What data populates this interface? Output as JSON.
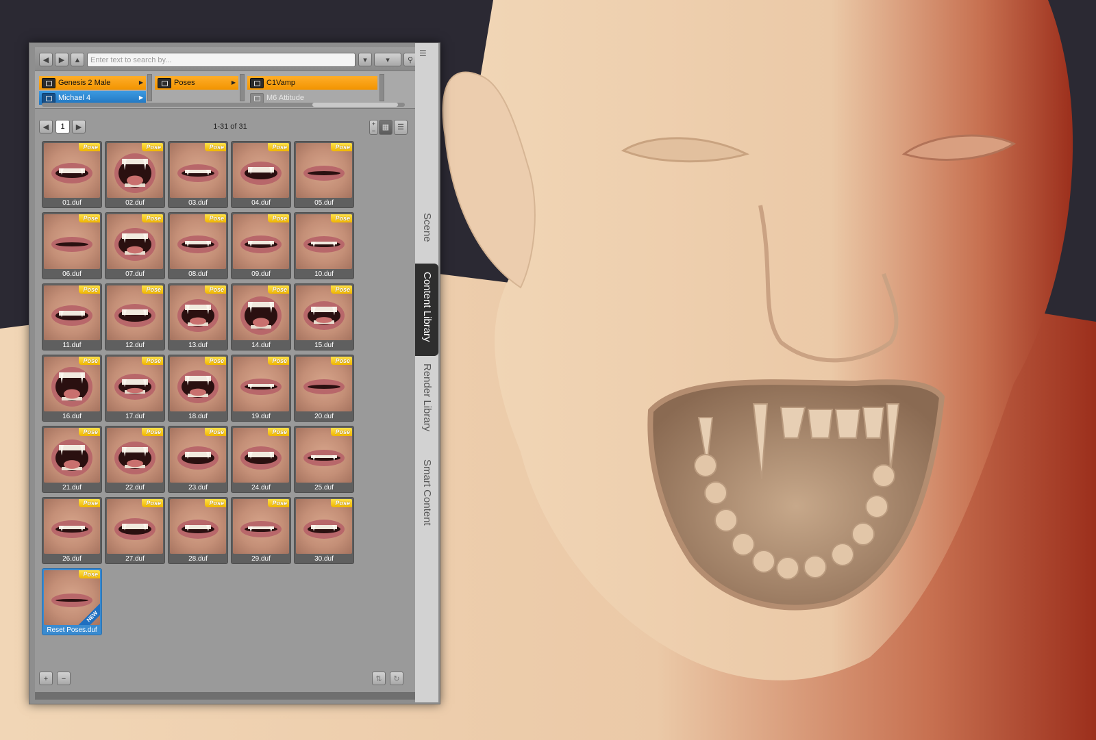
{
  "toolbar": {
    "back_icon": "back-arrow-icon",
    "forward_icon": "forward-arrow-icon",
    "up_icon": "up-arrow-icon",
    "search_placeholder": "Enter text to search by..."
  },
  "paths": {
    "col1": [
      {
        "label": "Genesis 2 Male",
        "state": "selected"
      },
      {
        "label": "Michael 4",
        "state": "highlighted"
      }
    ],
    "col2": [
      {
        "label": "Poses",
        "state": "selected"
      }
    ],
    "col3": [
      {
        "label": "C1Vamp",
        "state": "selected"
      },
      {
        "label": "M6 Attitude",
        "state": "normal"
      }
    ]
  },
  "pager": {
    "page": "1",
    "count": "1-31 of 31"
  },
  "badge": "Pose",
  "new_flag": "NEW",
  "items": [
    {
      "label": "01.duf",
      "open": 0.25
    },
    {
      "label": "02.duf",
      "open": 0.95
    },
    {
      "label": "03.duf",
      "open": 0.15
    },
    {
      "label": "04.duf",
      "open": 0.35
    },
    {
      "label": "05.duf",
      "open": 0.05
    },
    {
      "label": "06.duf",
      "open": 0.05
    },
    {
      "label": "07.duf",
      "open": 0.7
    },
    {
      "label": "08.duf",
      "open": 0.15
    },
    {
      "label": "09.duf",
      "open": 0.15
    },
    {
      "label": "10.duf",
      "open": 0.1
    },
    {
      "label": "11.duf",
      "open": 0.25
    },
    {
      "label": "12.duf",
      "open": 0.35
    },
    {
      "label": "13.duf",
      "open": 0.7
    },
    {
      "label": "14.duf",
      "open": 0.9
    },
    {
      "label": "15.duf",
      "open": 0.55
    },
    {
      "label": "16.duf",
      "open": 0.95
    },
    {
      "label": "17.duf",
      "open": 0.45
    },
    {
      "label": "18.duf",
      "open": 0.7
    },
    {
      "label": "19.duf",
      "open": 0.1
    },
    {
      "label": "20.duf",
      "open": 0.05
    },
    {
      "label": "21.duf",
      "open": 0.85
    },
    {
      "label": "22.duf",
      "open": 0.7
    },
    {
      "label": "23.duf",
      "open": 0.35
    },
    {
      "label": "24.duf",
      "open": 0.35
    },
    {
      "label": "25.duf",
      "open": 0.1
    },
    {
      "label": "26.duf",
      "open": 0.15
    },
    {
      "label": "27.duf",
      "open": 0.3
    },
    {
      "label": "28.duf",
      "open": 0.2
    },
    {
      "label": "29.duf",
      "open": 0.1
    },
    {
      "label": "30.duf",
      "open": 0.2
    },
    {
      "label": "Reset Poses.duf",
      "open": 0.0,
      "selected": true,
      "is_new": true
    }
  ],
  "side_tabs": [
    {
      "label": "Scene",
      "active": false
    },
    {
      "label": "Content Library",
      "active": true
    },
    {
      "label": "Render Library",
      "active": false
    },
    {
      "label": "Smart Content",
      "active": false
    }
  ],
  "colors": {
    "folder_selected": "#f29400",
    "folder_highlight": "#1f75c0",
    "pose_badge": "#f0b600",
    "panel_bg": "#9a9a9a"
  },
  "bottom": {
    "add_icon": "plus-icon",
    "remove_icon": "minus-icon",
    "sync_icon": "sync-icon",
    "refresh_icon": "refresh-icon"
  }
}
